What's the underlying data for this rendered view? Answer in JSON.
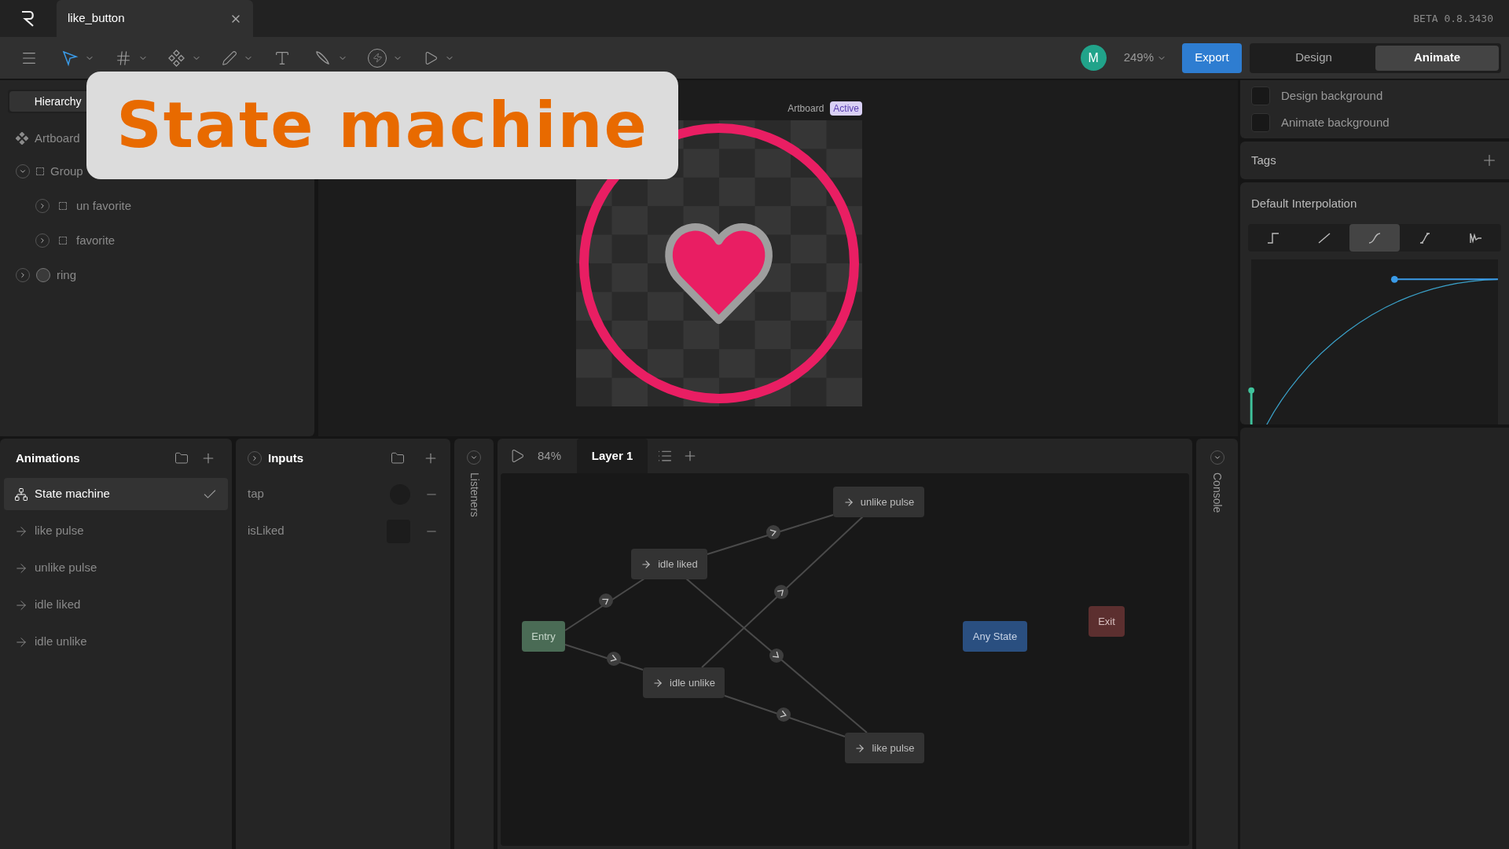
{
  "file_tab": {
    "title": "like_button"
  },
  "version": "BETA 0.8.3430",
  "toolbar": {
    "zoom": "249%",
    "export": "Export",
    "avatar": "M",
    "modes": [
      {
        "label": "Design",
        "selected": false
      },
      {
        "label": "Animate",
        "selected": true
      }
    ]
  },
  "left_panel": {
    "tabs": [
      {
        "label": "Hierarchy",
        "selected": true
      }
    ],
    "tree": [
      {
        "label": "Artboard",
        "children": [
          {
            "label": "Group",
            "expanded": true,
            "children": [
              {
                "label": "un favorite",
                "expanded": false
              },
              {
                "label": "favorite",
                "expanded": false
              }
            ]
          },
          {
            "label": "ring",
            "expanded": false
          }
        ]
      }
    ]
  },
  "canvas": {
    "artboard_label": "Artboard",
    "badge": "Active"
  },
  "overlay_title": "State machine",
  "right_panel": {
    "backgrounds": [
      "Design background",
      "Animate background"
    ],
    "tags": "Tags",
    "interpolation": {
      "title": "Default Interpolation",
      "options": [
        {
          "kind": "hold",
          "selected": false
        },
        {
          "kind": "linear",
          "selected": false
        },
        {
          "kind": "cubic",
          "selected": true
        },
        {
          "kind": "ease",
          "selected": false
        },
        {
          "kind": "elastic",
          "selected": false
        }
      ]
    }
  },
  "animations": {
    "title": "Animations",
    "items": [
      {
        "label": "State machine",
        "kind": "state_machine",
        "selected": true
      },
      {
        "label": "like pulse",
        "kind": "animation",
        "selected": false
      },
      {
        "label": "unlike pulse",
        "kind": "animation",
        "selected": false
      },
      {
        "label": "idle liked",
        "kind": "animation",
        "selected": false
      },
      {
        "label": "idle unlike",
        "kind": "animation",
        "selected": false
      }
    ]
  },
  "inputs": {
    "title": "Inputs",
    "items": [
      {
        "label": "tap",
        "kind": "trigger"
      },
      {
        "label": "isLiked",
        "kind": "boolean",
        "checked": false
      }
    ]
  },
  "listeners": "Listeners",
  "graph": {
    "zoom": "84%",
    "layers": [
      {
        "label": "Layer 1",
        "selected": true
      }
    ],
    "nodes": [
      {
        "label": "unlike pulse",
        "kind": "state"
      },
      {
        "label": "idle liked",
        "kind": "state"
      },
      {
        "label": "Entry",
        "kind": "entry"
      },
      {
        "label": "idle unlike",
        "kind": "state"
      },
      {
        "label": "like pulse",
        "kind": "state"
      },
      {
        "label": "Any State",
        "kind": "any"
      },
      {
        "label": "Exit",
        "kind": "exit"
      }
    ]
  },
  "console": "Console"
}
